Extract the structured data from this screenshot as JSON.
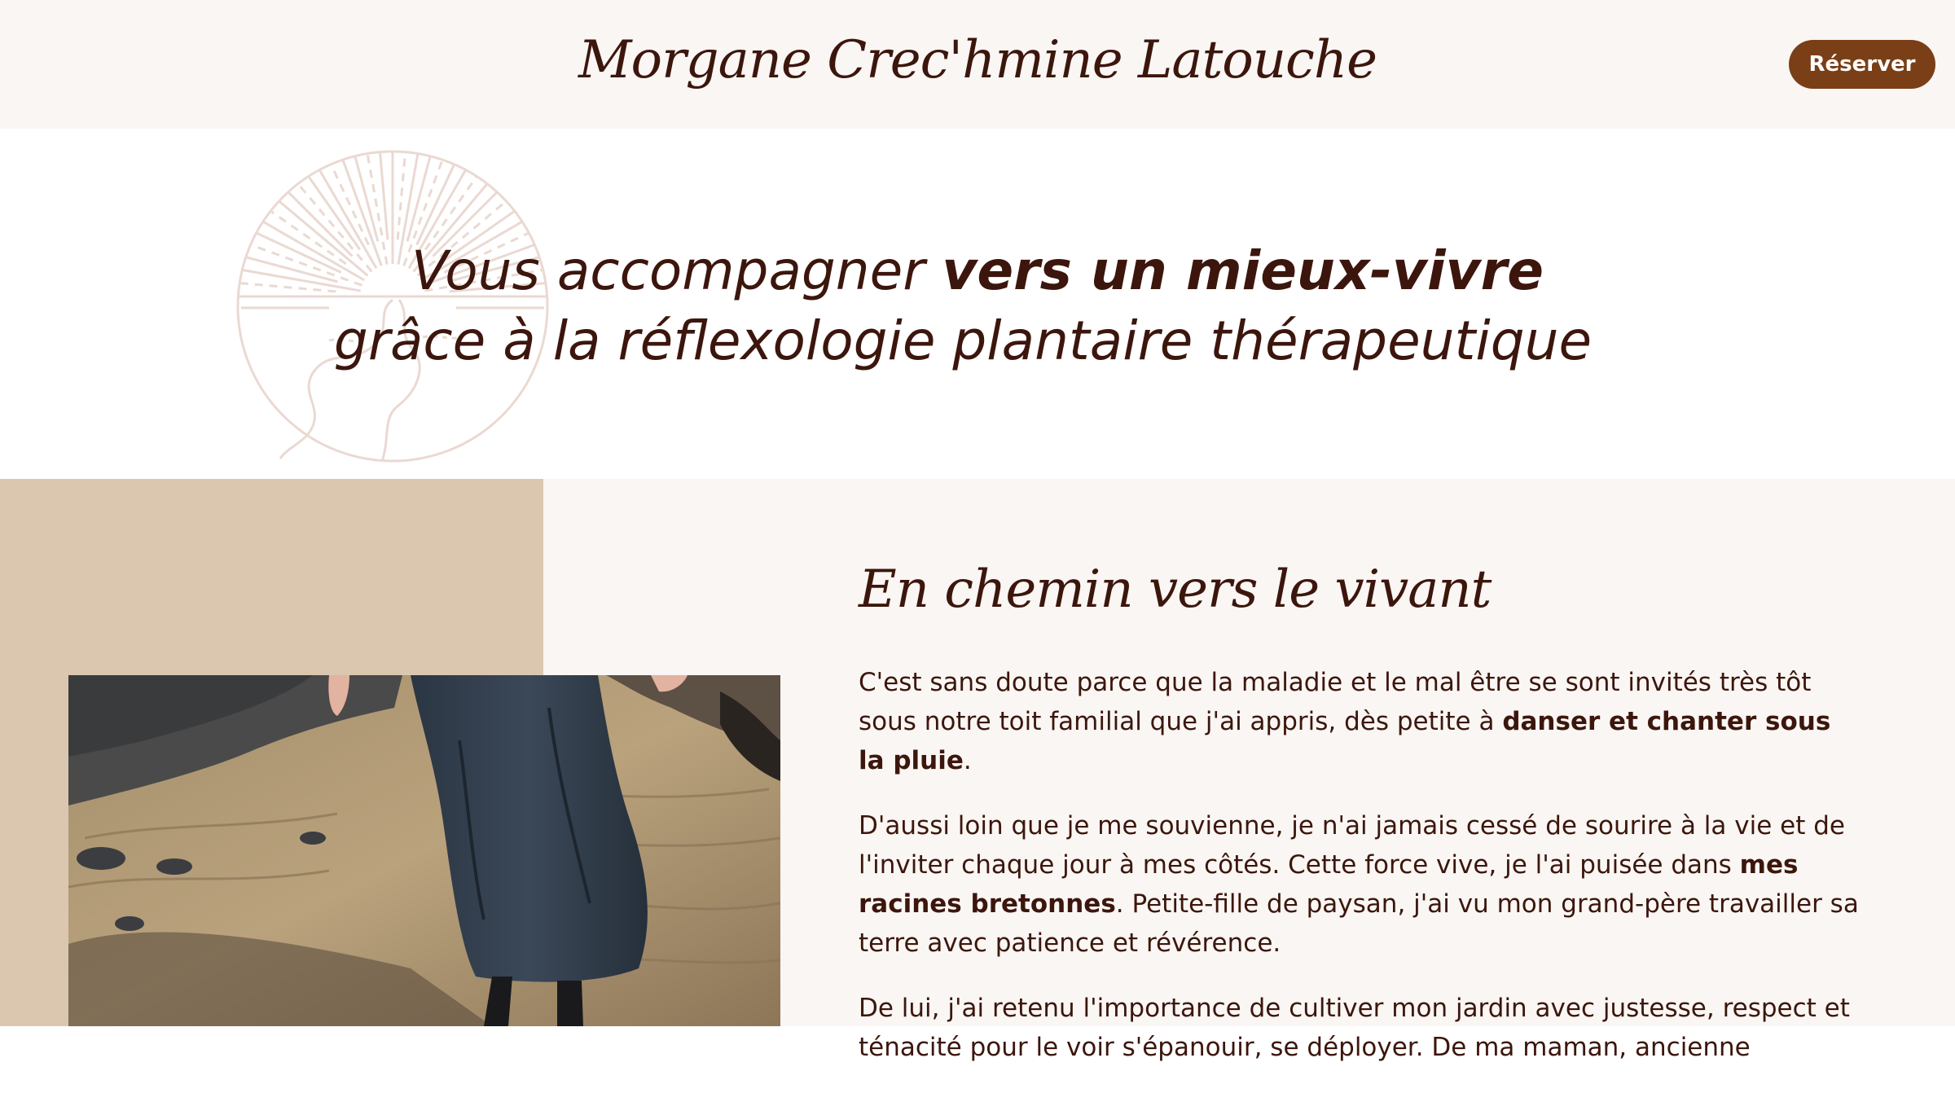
{
  "header": {
    "brand_name": "Morgane Crec'hmine Latouche",
    "reserve_label": "Réserver"
  },
  "hero": {
    "title_part1": "Vous accompagner ",
    "title_part1_bold": "vers un mieux-vivre",
    "title_line2": "grâce à la réflexologie plantaire thérapeutique",
    "logo_icon": "sun-river-logo-icon"
  },
  "about": {
    "section_title": "En chemin vers le vivant",
    "p1_text": "C'est sans doute parce que la maladie et le mal être se sont invités très tôt sous notre toit familial que j'ai appris, dès petite à ",
    "p1_bold": "danser et chanter sous la pluie",
    "p1_end": ".",
    "p2_text": "D'aussi loin que je me souvienne, je n'ai jamais cessé de sourire à la vie et de l'inviter chaque jour à mes côtés. Cette force vive, je l'ai puisée dans ",
    "p2_bold": "mes racines bretonnes",
    "p2_end": ". Petite-fille de paysan, j'ai vu mon grand-père travailler sa terre avec patience et révérence.",
    "p3_text": "De lui, j'ai retenu l'importance de cultiver mon jardin avec justesse, respect et ténacité pour le voir s'épanouir, se déployer. De ma maman, ancienne",
    "photo_icon": "photo-person-walking-on-rocks"
  },
  "colors": {
    "brand_dark": "#3c160d",
    "button_brown": "#7a3f17",
    "header_bg": "#f9f6f3",
    "beige": "#dbc7b0",
    "logo_line": "#e9d9d2"
  }
}
